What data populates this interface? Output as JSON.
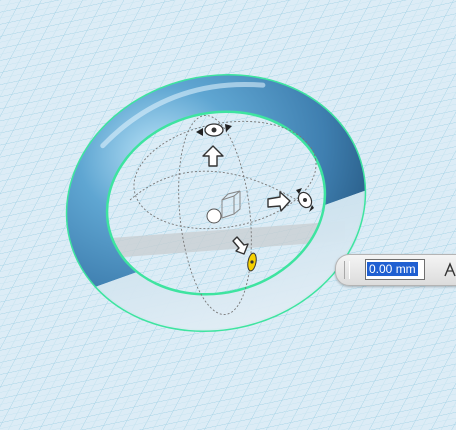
{
  "viewport": {
    "background_color": "#dcecf6",
    "grid_color": "#9fd0e4",
    "object": "torus",
    "object_color": "#4d8fbf",
    "selection_outline_color": "#3ee4a0"
  },
  "manipulator": {
    "move_up_icon": "arrow-up-icon",
    "move_right_icon": "arrow-right-icon",
    "move_down_icon": "arrow-down-icon",
    "rotate_handle_icon": "rotate-handle-icon",
    "center_handle_icon": "pivot-handle-icon",
    "active_handle_color": "#f5d000"
  },
  "dimension_input": {
    "value": "0.00 mm"
  },
  "toolbar": {
    "snap_icon": "snap-icon"
  }
}
